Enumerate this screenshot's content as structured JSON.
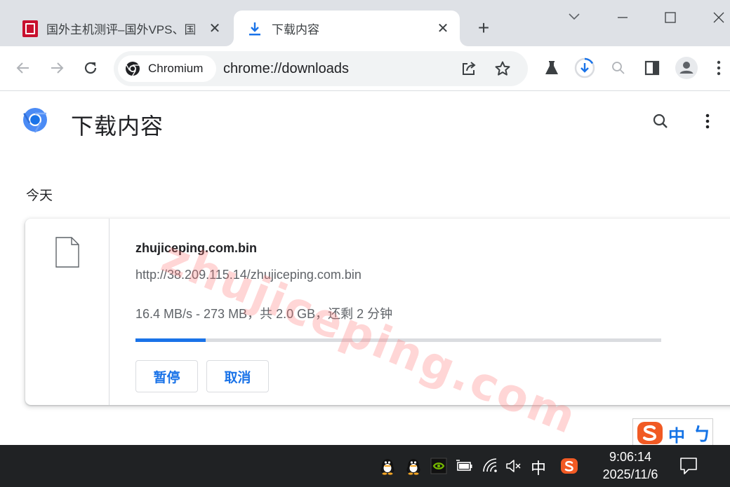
{
  "tabs": [
    {
      "title": "国外主机测评–国外VPS、国",
      "active": false,
      "favicon": "site-seal-icon"
    },
    {
      "title": "下载内容",
      "active": true,
      "favicon": "download-icon"
    }
  ],
  "toolbar": {
    "chip_label": "Chromium",
    "url": "chrome://downloads"
  },
  "page": {
    "title": "下载内容",
    "section_date": "今天"
  },
  "download": {
    "file_name": "zhujiceping.com.bin",
    "url": "http://38.209.115.14/zhujiceping.com.bin",
    "status": "16.4 MB/s - 273 MB，共 2.0 GB，还剩 2 分钟",
    "progress_fraction": 0.1333,
    "pause_label": "暂停",
    "cancel_label": "取消"
  },
  "watermark": "zhujiceping.com",
  "ime": {
    "mode": "中",
    "punct": "ㄅ"
  },
  "taskbar": {
    "ime_indicator": "中",
    "time": "9:06:14",
    "date": "2025/11/6"
  },
  "colors": {
    "accent": "#1a73e8",
    "tabstrip": "#dee1e6",
    "taskbar": "#202224"
  }
}
